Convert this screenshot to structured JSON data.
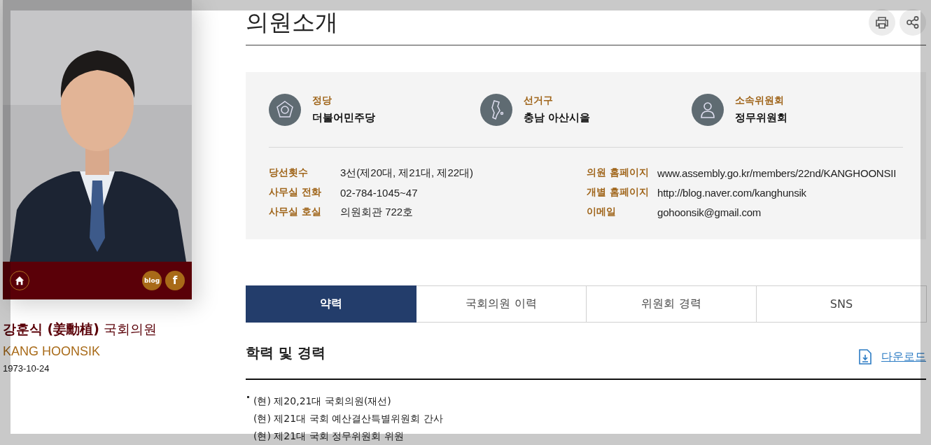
{
  "profile": {
    "name": "**강훈식 (姜勳植)** 국회의원",
    "name_en": "KANG HOONSIK",
    "birth_date": "1973-10-24",
    "links": [
      {
        "kind": "blog",
        "label": "blog"
      },
      {
        "kind": "facebook",
        "label": "f"
      }
    ]
  },
  "page_title": "의원소개",
  "summary": [
    {
      "kind": "party",
      "label": "정당",
      "value": "더불어민주당"
    },
    {
      "kind": "district",
      "label": "선거구",
      "value": "충남 아산시을"
    },
    {
      "kind": "committee",
      "label": "소속위원회",
      "value": "정무위원회"
    }
  ],
  "details_left": [
    {
      "label": "당선횟수",
      "value": "3선(제20대, 제21대, 제22대)"
    },
    {
      "label": "사무실 전화",
      "value": "02-784-1045~47"
    },
    {
      "label": "사무실 호실",
      "value": "의원회관 722호"
    }
  ],
  "details_right": [
    {
      "label": "의원 홈페이지",
      "value": "www.assembly.go.kr/members/22nd/KANGHOONSII"
    },
    {
      "label": "개별 홈페이지",
      "value": "http://blog.naver.com/kanghunsik"
    },
    {
      "label": "이메일",
      "value": "gohoonsik@gmail.com"
    }
  ],
  "tabs": [
    {
      "label": "약력",
      "selected": true
    },
    {
      "label": "국회의원 이력",
      "selected": false
    },
    {
      "label": "위원회 경력",
      "selected": false
    },
    {
      "label": "SNS",
      "selected": false
    }
  ],
  "section": {
    "title": "학력 및 경력",
    "download": "다운로드",
    "items": [
      "(현) 제20,21대 국회의원(재선)",
      "(현) 제21대 국회 예산결산특별위원회 간사",
      "(현) 제21대 국회 정무위원회 위원"
    ]
  }
}
